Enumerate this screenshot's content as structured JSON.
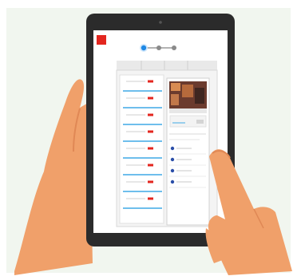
{
  "illustration": {
    "subject": "hands-holding-tablet",
    "colors": {
      "background": "#f1f6ef",
      "tablet_frame": "#2b2b2b",
      "screen": "#ffffff",
      "skin": "#f0a06a",
      "skin_shadow": "#e08855",
      "accent_red": "#e3261f",
      "accent_blue": "#1e88e5",
      "line_blue": "#3fa9e6",
      "divider_gray": "#cfcfcf",
      "panel_gray": "#e9e9e9"
    },
    "stepper": {
      "steps": 3,
      "active_step": 1
    },
    "form_rows": 8,
    "preview_list_items": 4
  }
}
